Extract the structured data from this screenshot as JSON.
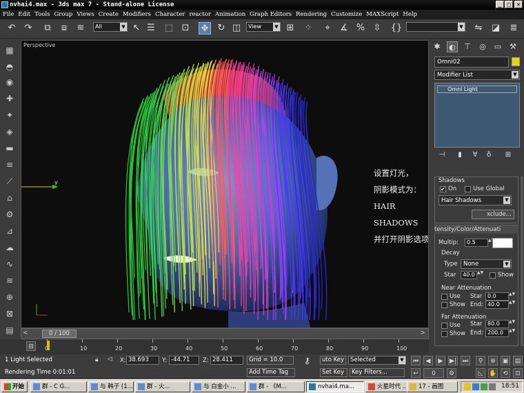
{
  "window": {
    "title": "nvhai4.max - 3ds max 7 - Stand-alone License"
  },
  "menu": [
    "File",
    "Edit",
    "Tools",
    "Group",
    "Views",
    "Create",
    "Modifiers",
    "Character",
    "reactor",
    "Animation",
    "Graph Editors",
    "Rendering",
    "Customize",
    "MAXScript",
    "Help"
  ],
  "toolbar": {
    "selection_filter": "All",
    "reference_coord": "View",
    "named_selection": ""
  },
  "viewport": {
    "label": "Perspective",
    "axis_label": "y",
    "annotation": [
      "设置灯光，",
      "阴影模式为：",
      "HAIR SHADOWS",
      "并打开阴影选项"
    ]
  },
  "command_panel": {
    "object_name": "Omni02",
    "object_color": "#e8d400",
    "modifier_list": "Modifier List",
    "stack_item": "Omni Light",
    "shadows": {
      "title": "Shadows",
      "on_label": "On",
      "on_checked": true,
      "use_global_label": "Use Global",
      "use_global_checked": false,
      "type": "Hair Shadows",
      "exclude_label": "xclude..."
    },
    "intensity": {
      "title": "tensity/Color/Attenuati",
      "multiplier_label": "Multip:",
      "multiplier": "0.5",
      "decay_title": "Decay",
      "type_label": "Type",
      "type_value": "None",
      "start_label": "Star",
      "start_value": "40.0",
      "show_label": "Show",
      "near_title": "Near Attenuation",
      "near_use": "Use",
      "near_show": "Show",
      "near_start_label": "Star",
      "near_start": "0.0",
      "near_end_label": "End:",
      "near_end": "40.0",
      "far_title": "Far Attenuation",
      "far_use": "Use",
      "far_show": "Show",
      "far_start_label": "Star",
      "far_start": "80.0",
      "far_end_label": "End:",
      "far_end": "200.0"
    }
  },
  "timeline": {
    "frame_label": "0 / 100",
    "current_frame": 0,
    "total_frames": 100,
    "ticks": [
      "0",
      "10",
      "20",
      "30",
      "40",
      "50",
      "60",
      "70",
      "80",
      "90",
      "100"
    ]
  },
  "status": {
    "selection": "1 Light Selected",
    "rendering_time": "Rendering Time  0:01:01",
    "x_label": "X:",
    "x": "38.693",
    "y_label": "Y:",
    "y": "-44.71",
    "z_label": "Z:",
    "z": "28.411",
    "grid": "Grid = 10.0",
    "add_time_tag": "Add Time Tag",
    "auto_key": "uto Key",
    "auto_key_mode": "Selected",
    "set_key": "Set Key",
    "key_filters": "Key Filters..."
  },
  "taskbar": {
    "start": "开始",
    "tasks": [
      "群 - C G...",
      "与 韩子 (1...",
      "群 - 火...",
      "与 白金小 ...",
      "群 - 《M...",
      "nvhai4.ma...",
      "火星时代 ...",
      "17 - 画图"
    ],
    "clock": "18:51"
  }
}
